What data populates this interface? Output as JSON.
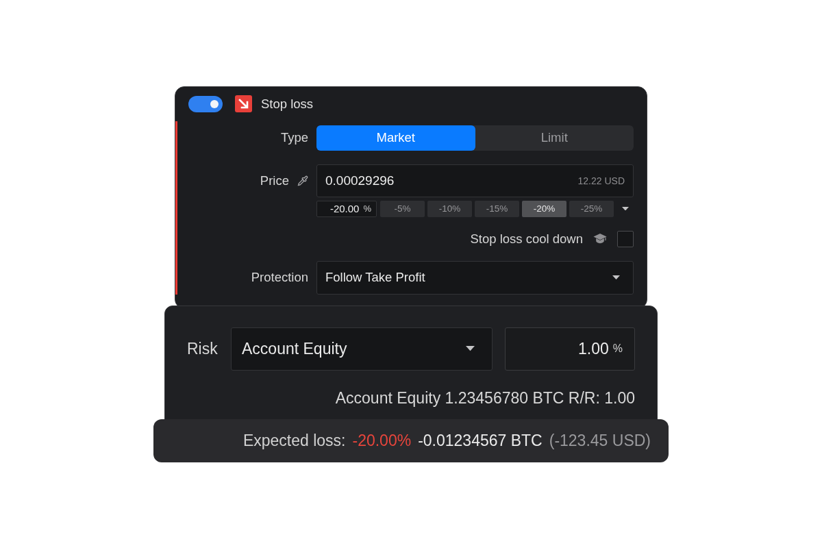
{
  "stop_loss": {
    "on": true,
    "title": "Stop loss"
  },
  "type": {
    "label": "Type",
    "options": [
      {
        "label": "Market",
        "selected": true
      },
      {
        "label": "Limit",
        "selected": false
      }
    ]
  },
  "price": {
    "label": "Price",
    "value": "0.00029296",
    "conversion": "12.22 USD",
    "percent_value": "-20.00",
    "percent_unit": "%",
    "presets": [
      {
        "label": "-5%",
        "selected": false
      },
      {
        "label": "-10%",
        "selected": false
      },
      {
        "label": "-15%",
        "selected": false
      },
      {
        "label": "-20%",
        "selected": true
      },
      {
        "label": "-25%",
        "selected": false
      }
    ]
  },
  "cool_down": {
    "label": "Stop loss cool down",
    "checked": false
  },
  "protection": {
    "label": "Protection",
    "value": "Follow Take Profit"
  },
  "risk": {
    "label": "Risk",
    "mode": "Account Equity",
    "value": "1.00",
    "unit": "%",
    "summary": "Account Equity 1.23456780 BTC R/R: 1.00"
  },
  "expected_loss": {
    "label": "Expected loss:",
    "percent": "-20.00%",
    "amount": "-0.01234567 BTC",
    "fiat": "(-123.45 USD)"
  }
}
